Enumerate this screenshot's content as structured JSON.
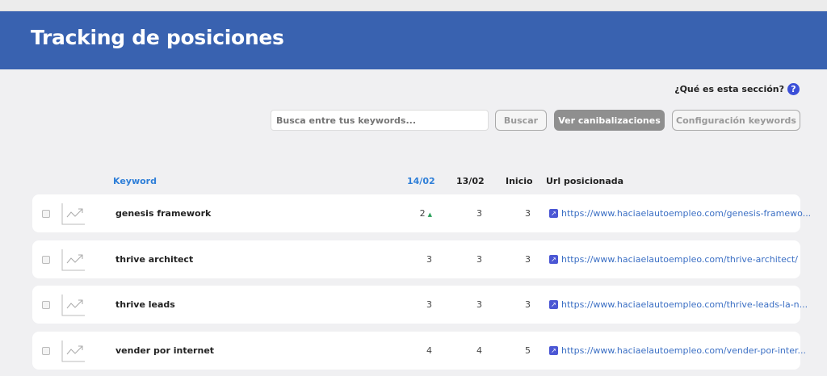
{
  "header": {
    "title": "Tracking de posiciones"
  },
  "help": {
    "label": "¿Qué es esta sección?",
    "icon": "question-icon"
  },
  "toolbar": {
    "search_placeholder": "Busca entre tus keywords...",
    "search_label": "Buscar",
    "canibal_label": "Ver canibalizaciones",
    "config_label": "Configuración keywords"
  },
  "table": {
    "headers": {
      "keyword": "Keyword",
      "d1": "14/02",
      "d2": "13/02",
      "inicio": "Inicio",
      "url": "Url posicionada"
    },
    "rows": [
      {
        "keyword": "genesis framework",
        "d1": "2",
        "trend": "up",
        "d2": "3",
        "inicio": "3",
        "url": "https://www.haciaelautoempleo.com/genesis-framewo..."
      },
      {
        "keyword": "thrive architect",
        "d1": "3",
        "d2": "3",
        "inicio": "3",
        "url": "https://www.haciaelautoempleo.com/thrive-architect/"
      },
      {
        "keyword": "thrive leads",
        "d1": "3",
        "d2": "3",
        "inicio": "3",
        "url": "https://www.haciaelautoempleo.com/thrive-leads-la-n..."
      },
      {
        "keyword": "vender por internet",
        "d1": "4",
        "d2": "4",
        "inicio": "5",
        "url": "https://www.haciaelautoempleo.com/vender-por-inter..."
      }
    ]
  },
  "colors": {
    "header": "#3962b0",
    "accent": "#2f7fd8",
    "up": "#2aa05a"
  }
}
